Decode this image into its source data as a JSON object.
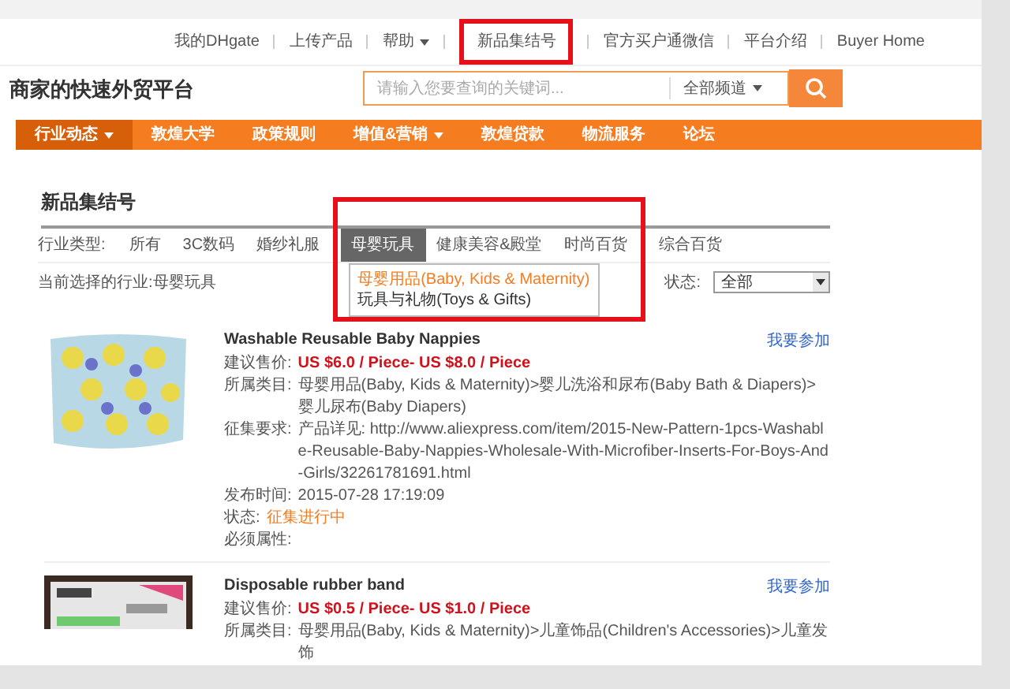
{
  "top_links": [
    {
      "label": "我的DHgate",
      "caret": false
    },
    {
      "label": "上传产品",
      "caret": false
    },
    {
      "label": "帮助",
      "caret": true
    },
    {
      "label": "新品集结号",
      "caret": false,
      "highlighted": true
    },
    {
      "label": "官方买户通微信",
      "caret": false
    },
    {
      "label": "平台介绍",
      "caret": false
    },
    {
      "label": "Buyer Home",
      "caret": false
    }
  ],
  "header": {
    "logo_text": "商家的快速外贸平台",
    "search": {
      "placeholder": "请输入您要查询的关键词...",
      "scope": "全部频道"
    }
  },
  "nav": [
    {
      "label": "行业动态",
      "caret": true,
      "selected": true
    },
    {
      "label": "敦煌大学",
      "caret": false,
      "selected": false
    },
    {
      "label": "政策规则",
      "caret": false,
      "selected": false
    },
    {
      "label": "增值&营销",
      "caret": true,
      "selected": false
    },
    {
      "label": "敦煌贷款",
      "caret": false,
      "selected": false
    },
    {
      "label": "物流服务",
      "caret": false,
      "selected": false
    },
    {
      "label": "论坛",
      "caret": false,
      "selected": false
    }
  ],
  "page_title": "新品集结号",
  "filter": {
    "label": "行业类型:",
    "tabs": [
      {
        "label": "所有",
        "selected": false
      },
      {
        "label": "3C数码",
        "selected": false
      },
      {
        "label": "婚纱礼服",
        "selected": false
      },
      {
        "label": "母婴玩具",
        "selected": true,
        "highlighted": true
      },
      {
        "label": "健康美容&殿堂",
        "selected": false,
        "highlighted": true
      },
      {
        "label": "时尚百货",
        "selected": false,
        "highlighted": true
      },
      {
        "label": "综合百货",
        "selected": false
      }
    ],
    "dropdown": [
      {
        "label": "母婴用品(Baby, Kids & Maternity)",
        "selected": true
      },
      {
        "label": "玩具与礼物(Toys & Gifts)",
        "selected": false
      }
    ]
  },
  "current": {
    "label": "当前选择的行业:",
    "value": "母婴玩具"
  },
  "status_filter": {
    "label": "状态:",
    "value": "全部"
  },
  "products": [
    {
      "title": "Washable Reusable Baby Nappies",
      "join": "我要参加",
      "fields": [
        {
          "kind": "price",
          "label": "建议售价:",
          "value": "US $6.0 / Piece- US $8.0 / Piece"
        },
        {
          "kind": "text",
          "label": "所属类目:",
          "value": "母婴用品(Baby, Kids & Maternity)>婴儿洗浴和尿布(Baby Bath & Diapers)>婴儿尿布(Baby Diapers)"
        },
        {
          "kind": "text",
          "label": "征集要求:",
          "value": "产品详见: http://www.aliexpress.com/item/2015-New-Pattern-1pcs-Washable-Reusable-Baby-Nappies-Wholesale-With-Microfiber-Inserts-For-Boys-And-Girls/32261781691.html"
        },
        {
          "kind": "text",
          "label": "发布时间:",
          "value": "2015-07-28 17:19:09"
        },
        {
          "kind": "status",
          "label": "状态:",
          "value": "征集进行中"
        },
        {
          "kind": "text",
          "label": "必须属性:"
        }
      ]
    },
    {
      "title": "Disposable rubber band",
      "join": "我要参加",
      "fields": [
        {
          "kind": "price",
          "label": "建议售价:",
          "value": "US $0.5 / Piece- US $1.0 / Piece"
        },
        {
          "kind": "text",
          "label": "所属类目:",
          "value": "母婴用品(Baby, Kids & Maternity)>儿童饰品(Children's Accessories)>儿童发饰"
        }
      ]
    }
  ]
}
